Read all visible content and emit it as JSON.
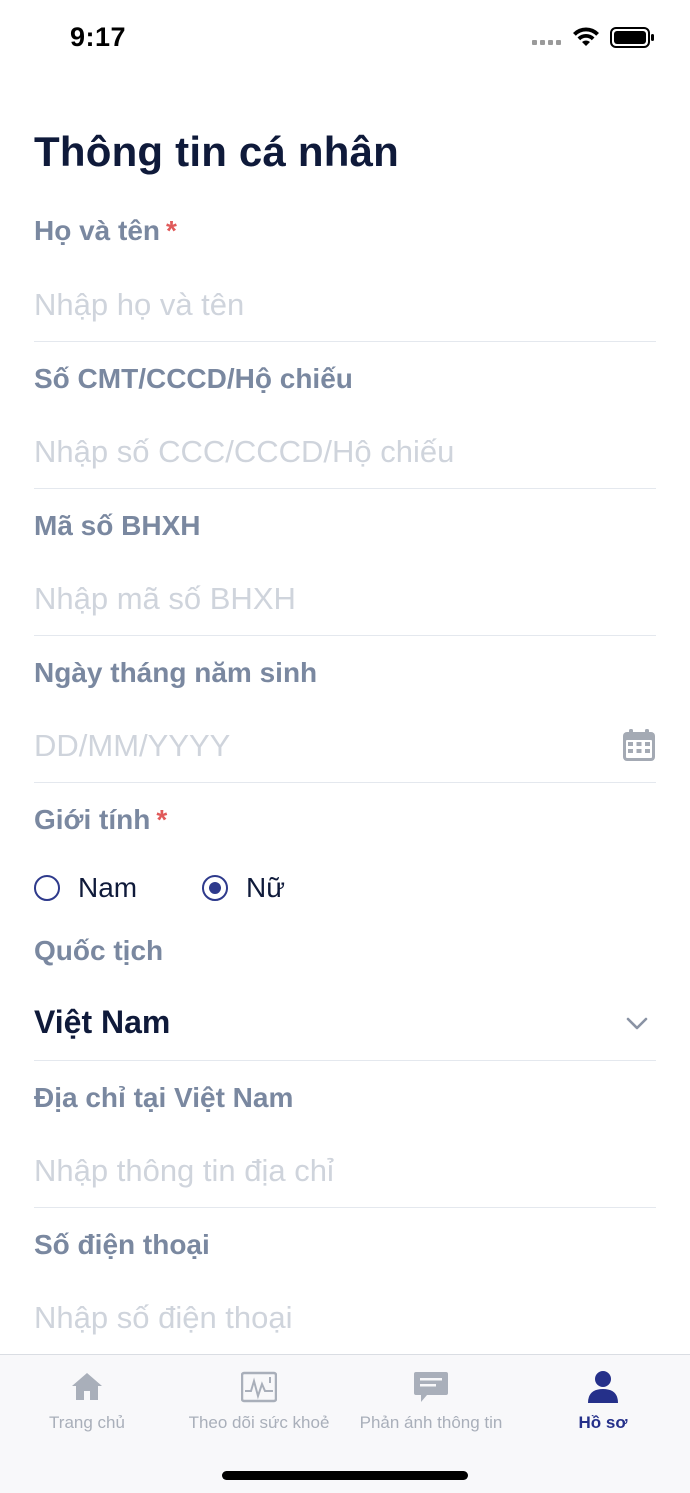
{
  "status": {
    "time": "9:17"
  },
  "page": {
    "title": "Thông tin cá nhân"
  },
  "fields": {
    "full_name": {
      "label": "Họ và tên",
      "required_mark": "*",
      "placeholder": "Nhập họ và tên",
      "value": ""
    },
    "id_number": {
      "label": "Số CMT/CCCD/Hộ chiếu",
      "placeholder": "Nhập số CCC/CCCD/Hộ chiếu",
      "value": ""
    },
    "social_insurance": {
      "label": "Mã số BHXH",
      "placeholder": "Nhập mã số BHXH",
      "value": ""
    },
    "birth_date": {
      "label": "Ngày tháng năm sinh",
      "placeholder": "DD/MM/YYYY",
      "value": "",
      "icon": "calendar-icon"
    },
    "gender": {
      "label": "Giới tính",
      "required_mark": "*",
      "options": [
        "Nam",
        "Nữ"
      ],
      "selected": "Nữ"
    },
    "nationality": {
      "label": "Quốc tịch",
      "value": "Việt Nam",
      "icon": "chevron-down-icon"
    },
    "address": {
      "label": "Địa chỉ tại Việt Nam",
      "placeholder": "Nhập thông tin địa chỉ",
      "value": ""
    },
    "phone": {
      "label": "Số điện thoại",
      "placeholder": "Nhập số điện thoại",
      "value": ""
    }
  },
  "tabs": [
    {
      "label": "Trang chủ",
      "icon": "home-icon",
      "active": false
    },
    {
      "label": "Theo dõi sức khoẻ",
      "icon": "health-monitor-icon",
      "active": false
    },
    {
      "label": "Phản ánh thông tin",
      "icon": "feedback-message-icon",
      "active": false
    },
    {
      "label": "Hồ sơ",
      "icon": "profile-icon",
      "active": true
    }
  ],
  "colors": {
    "accent": "#25308a",
    "label": "#7a88a0",
    "required": "#e05a5a",
    "placeholder": "#cfd4dc",
    "text": "#0f1a3a",
    "tab_inactive": "#a9afba"
  }
}
